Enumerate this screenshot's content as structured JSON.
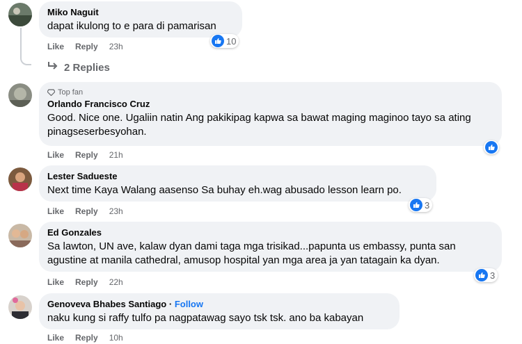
{
  "comments": [
    {
      "author": "Miko Naguit",
      "text": "dapat ikulong to e para di pamarisan",
      "like": "Like",
      "reply": "Reply",
      "time": "23h",
      "reactions": "10"
    },
    {
      "badge": "Top fan",
      "author": "Orlando Francisco Cruz",
      "text": "Good. Nice one. Ugaliin natin Ang pakikipag kapwa sa bawat maging maginoo tayo sa ating pinagseserbesyohan.",
      "like": "Like",
      "reply": "Reply",
      "time": "21h",
      "reactions": ""
    },
    {
      "author": "Lester Sadueste",
      "text": "Next time Kaya Walang aasenso Sa buhay eh.wag abusado lesson learn po.",
      "like": "Like",
      "reply": "Reply",
      "time": "23h",
      "reactions": "3"
    },
    {
      "author": "Ed Gonzales",
      "text": "Sa lawton, UN ave, kalaw dyan dami taga mga trisikad...papunta us embassy, punta san agustine at manila cathedral, amusop hospital yan mga area ja yan tatagain ka dyan.",
      "like": "Like",
      "reply": "Reply",
      "time": "22h",
      "reactions": "3"
    },
    {
      "author": "Genoveva Bhabes Santiago",
      "separator": "·",
      "follow": "Follow",
      "text": "naku kung si raffy tulfo pa nagpatawag sayo tsk tsk. ano ba kabayan",
      "like": "Like",
      "reply": "Reply",
      "time": "10h"
    }
  ],
  "replies_link": "2 Replies",
  "colors": {
    "accent": "#1877f2",
    "bubble": "#f0f2f5",
    "secondary_text": "#65676b"
  },
  "icons": {
    "like_reaction": "thumbs-up-icon",
    "reply_arrow": "reply-arrow-icon",
    "top_fan": "diamond-icon"
  }
}
